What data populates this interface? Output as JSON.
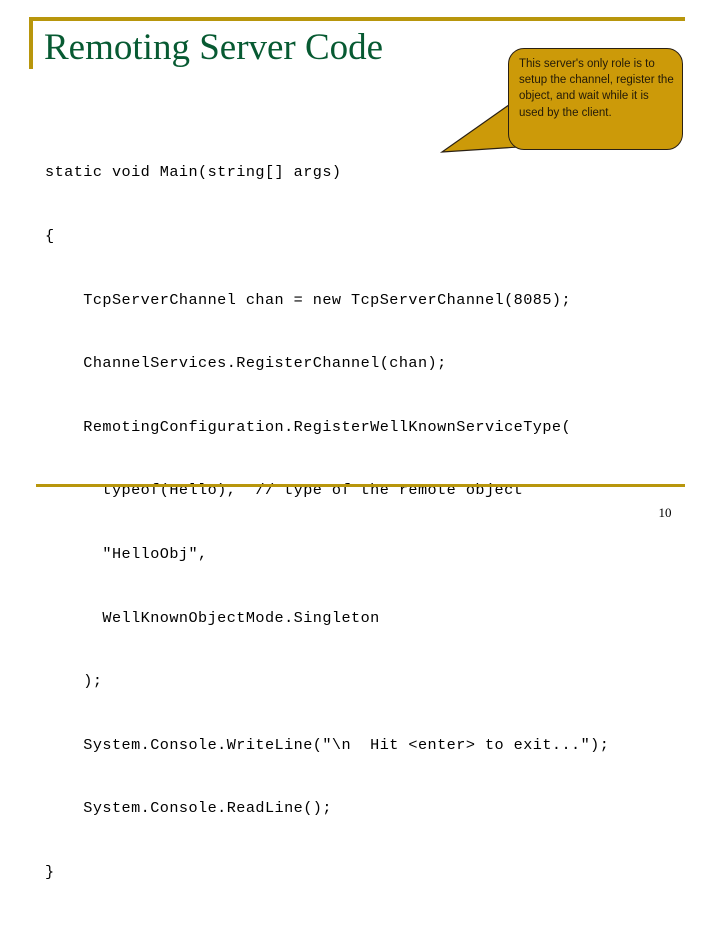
{
  "slide": {
    "title": "Remoting Server Code",
    "number": "10",
    "accent_color": "#b8960c",
    "title_color": "#075a32",
    "callout_fill": "#cc9a09",
    "callout_border": "#2a2013",
    "background": "#ffffff"
  },
  "callout": {
    "text": "This server's only role is to setup the channel, register the object, and wait while it is used by the client."
  },
  "code": {
    "language": "csharp",
    "lines": [
      "static void Main(string[] args)",
      "{",
      "    TcpServerChannel chan = new TcpServerChannel(8085);",
      "    ChannelServices.RegisterChannel(chan);",
      "    RemotingConfiguration.RegisterWellKnownServiceType(",
      "      typeof(Hello),  // type of the remote object",
      "      \"HelloObj\",",
      "      WellKnownObjectMode.Singleton",
      "    );",
      "    System.Console.WriteLine(\"\\n  Hit <enter> to exit...\");",
      "    System.Console.ReadLine();",
      "}"
    ]
  }
}
